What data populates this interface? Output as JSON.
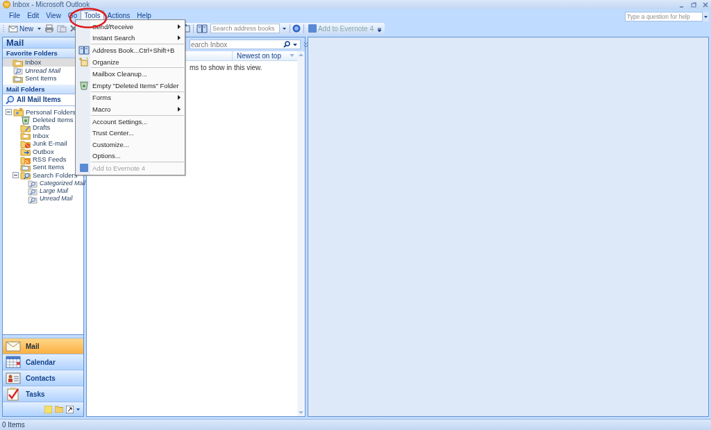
{
  "window": {
    "title": "Inbox - Microsoft Outlook"
  },
  "menubar": [
    {
      "label": "File",
      "selected": false
    },
    {
      "label": "Edit",
      "selected": false
    },
    {
      "label": "View",
      "selected": false
    },
    {
      "label": "Go",
      "selected": false
    },
    {
      "label": "Tools",
      "selected": true
    },
    {
      "label": "Actions",
      "selected": false
    },
    {
      "label": "Help",
      "selected": false
    }
  ],
  "help_box": {
    "placeholder": "Type a question for help"
  },
  "toolbar": {
    "new_button": "New",
    "address_search": {
      "placeholder": "Search address books"
    },
    "evernote_button": "Add to Evernote 4"
  },
  "tools_menu": {
    "groups": [
      [
        {
          "label": "Send/Receive",
          "kind": "command",
          "submenu": true,
          "disabled": false
        },
        {
          "label": "Instant Search",
          "kind": "command",
          "submenu": true,
          "disabled": false
        }
      ],
      [
        {
          "label": "Address Book...",
          "shortcut": "Ctrl+Shift+B",
          "kind": "address_book",
          "submenu": false,
          "disabled": false
        },
        {
          "label": "Organize",
          "kind": "organize",
          "submenu": false,
          "disabled": false
        }
      ],
      [
        {
          "label": "Mailbox Cleanup...",
          "kind": "command",
          "submenu": false,
          "disabled": false
        },
        {
          "label": "Empty \"Deleted Items\" Folder",
          "kind": "empty_trash",
          "submenu": false,
          "disabled": false
        }
      ],
      [
        {
          "label": "Forms",
          "kind": "command",
          "submenu": true,
          "disabled": false
        },
        {
          "label": "Macro",
          "kind": "command",
          "submenu": true,
          "disabled": false
        }
      ],
      [
        {
          "label": "Account Settings...",
          "kind": "command",
          "submenu": false,
          "disabled": false
        },
        {
          "label": "Trust Center...",
          "kind": "command",
          "submenu": false,
          "disabled": false
        },
        {
          "label": "Customize...",
          "kind": "command",
          "submenu": false,
          "disabled": false
        },
        {
          "label": "Options...",
          "kind": "command",
          "submenu": false,
          "disabled": false
        }
      ],
      [
        {
          "label": "Add to Evernote 4",
          "kind": "evernote",
          "submenu": false,
          "disabled": true
        }
      ]
    ]
  },
  "navigation": {
    "title": "Mail",
    "favorites_header": "Favorite Folders",
    "favorites": [
      {
        "label": "Inbox",
        "kind": "inbox",
        "selected": true
      },
      {
        "label": "Unread Mail",
        "kind": "search",
        "selected": false
      },
      {
        "label": "Sent Items",
        "kind": "sent",
        "selected": false
      }
    ],
    "folders_header": "Mail Folders",
    "all_items": "All Mail Items",
    "tree": [
      {
        "label": "Personal Folders",
        "kind": "personal",
        "expanded": true,
        "children": [
          {
            "label": "Deleted Items",
            "kind": "trash"
          },
          {
            "label": "Drafts",
            "kind": "drafts"
          },
          {
            "label": "Inbox",
            "kind": "inbox"
          },
          {
            "label": "Junk E-mail",
            "kind": "junk"
          },
          {
            "label": "Outbox",
            "kind": "outbox"
          },
          {
            "label": "RSS Feeds",
            "kind": "rss"
          },
          {
            "label": "Sent Items",
            "kind": "sent"
          },
          {
            "label": "Search Folders",
            "kind": "searchroot",
            "expanded": true,
            "children": [
              {
                "label": "Categorized Mail",
                "kind": "search"
              },
              {
                "label": "Large Mail",
                "kind": "search"
              },
              {
                "label": "Unread Mail",
                "kind": "search"
              }
            ]
          }
        ]
      }
    ],
    "buttons": [
      {
        "label": "Mail",
        "kind": "mail",
        "selected": true
      },
      {
        "label": "Calendar",
        "kind": "calendar",
        "selected": false
      },
      {
        "label": "Contacts",
        "kind": "contacts",
        "selected": false
      },
      {
        "label": "Tasks",
        "kind": "tasks",
        "selected": false
      }
    ]
  },
  "message_list": {
    "search": {
      "placeholder": "earch Inbox"
    },
    "sort_order": "Newest on top",
    "empty_message": "ms to show in this view."
  },
  "status_bar": {
    "text": "0 Items"
  }
}
